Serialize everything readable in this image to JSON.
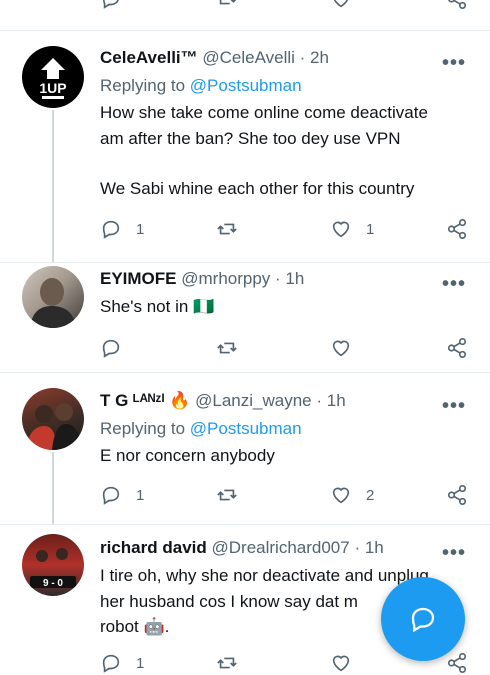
{
  "colors": {
    "accent": "#1d9bf0",
    "muted": "#536471",
    "text": "#0f1419"
  },
  "tweets": [
    {
      "name": "CeleAvelli™",
      "handle": "@CeleAvelli",
      "time": "· 2h",
      "replying_label": "Replying to",
      "replying_to": "@Postsubman",
      "lines": [
        "How she take come online come deactivate",
        "am after the ban? She too dey use VPN",
        "",
        "We Sabi whine each other for this country"
      ],
      "replies": "1",
      "retweets": "",
      "likes": "1",
      "avatar_icon": "1up-logo",
      "avatar_text": "1UP"
    },
    {
      "name": "EYIMOFE",
      "handle": "@mrhorppy",
      "time": "· 1h",
      "lines": [
        "She's not in 🇳🇬"
      ],
      "replies": "",
      "retweets": "",
      "likes": "",
      "avatar_icon": "profile-photo"
    },
    {
      "name": "T G ᴸᴬᴺᶻᴵ 🔥",
      "handle": "@Lanzi_wayne",
      "time": "· 1h",
      "replying_label": "Replying to",
      "replying_to": "@Postsubman",
      "lines": [
        "E nor concern anybody"
      ],
      "replies": "1",
      "retweets": "",
      "likes": "2",
      "avatar_icon": "profile-photo"
    },
    {
      "name": "richard david",
      "handle": "@Drealrichard007",
      "time": "· 1h",
      "lines": [
        "I tire oh, why she nor deactivate and unplug",
        "her husband cos I know say dat m",
        "robot 🤖."
      ],
      "replies": "1",
      "retweets": "",
      "likes": "",
      "avatar_icon": "profile-photo",
      "avatar_text": "9 - 0"
    }
  ],
  "fab": {
    "icon": "compose-reply-icon"
  }
}
